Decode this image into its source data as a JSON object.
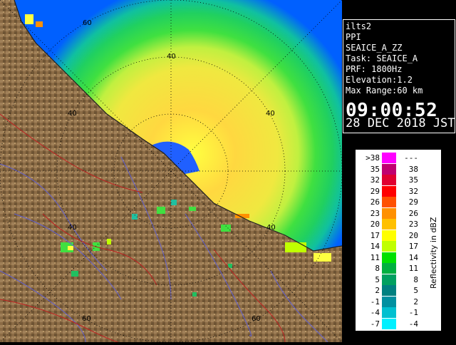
{
  "info": {
    "radar_name": "ilts2",
    "product": "PPI",
    "field": "SEAICE_A_ZZ",
    "task": "Task: SEAICE_A",
    "prf": "PRF: 1800Hz",
    "elevation": "Elevation:1.2",
    "max_range": "Max Range:60 km",
    "time": "09:00:52",
    "date": "28 DEC 2018 JST"
  },
  "legend": {
    "unit": "Reflectivity in dBZ",
    "rows": [
      {
        "lo": ">38",
        "hi": "---",
        "color": "#ff00ff"
      },
      {
        "lo": "35",
        "hi": "38",
        "color": "#c00070"
      },
      {
        "lo": "32",
        "hi": "35",
        "color": "#e00030"
      },
      {
        "lo": "29",
        "hi": "32",
        "color": "#ff0000"
      },
      {
        "lo": "26",
        "hi": "29",
        "color": "#ff5000"
      },
      {
        "lo": "23",
        "hi": "26",
        "color": "#ff9000"
      },
      {
        "lo": "20",
        "hi": "23",
        "color": "#ffc000"
      },
      {
        "lo": "17",
        "hi": "20",
        "color": "#ffff00"
      },
      {
        "lo": "14",
        "hi": "17",
        "color": "#c0ff00"
      },
      {
        "lo": "11",
        "hi": "14",
        "color": "#00e000"
      },
      {
        "lo": "8",
        "hi": "11",
        "color": "#00b040"
      },
      {
        "lo": "5",
        "hi": "8",
        "color": "#00a060"
      },
      {
        "lo": "2",
        "hi": "5",
        "color": "#008080"
      },
      {
        "lo": "-1",
        "hi": "2",
        "color": "#0090a0"
      },
      {
        "lo": "-4",
        "hi": "-1",
        "color": "#00c0d0"
      },
      {
        "lo": "-7",
        "hi": "-4",
        "color": "#00f0ff"
      }
    ]
  },
  "map": {
    "ring_labels": [
      "60",
      "40",
      "40",
      "40",
      "40",
      "40",
      "60",
      "60"
    ],
    "colors": {
      "land": "#8a6a44",
      "sea": "#0050ff",
      "rivers": "#6060d0",
      "borders": "#c02020"
    }
  }
}
